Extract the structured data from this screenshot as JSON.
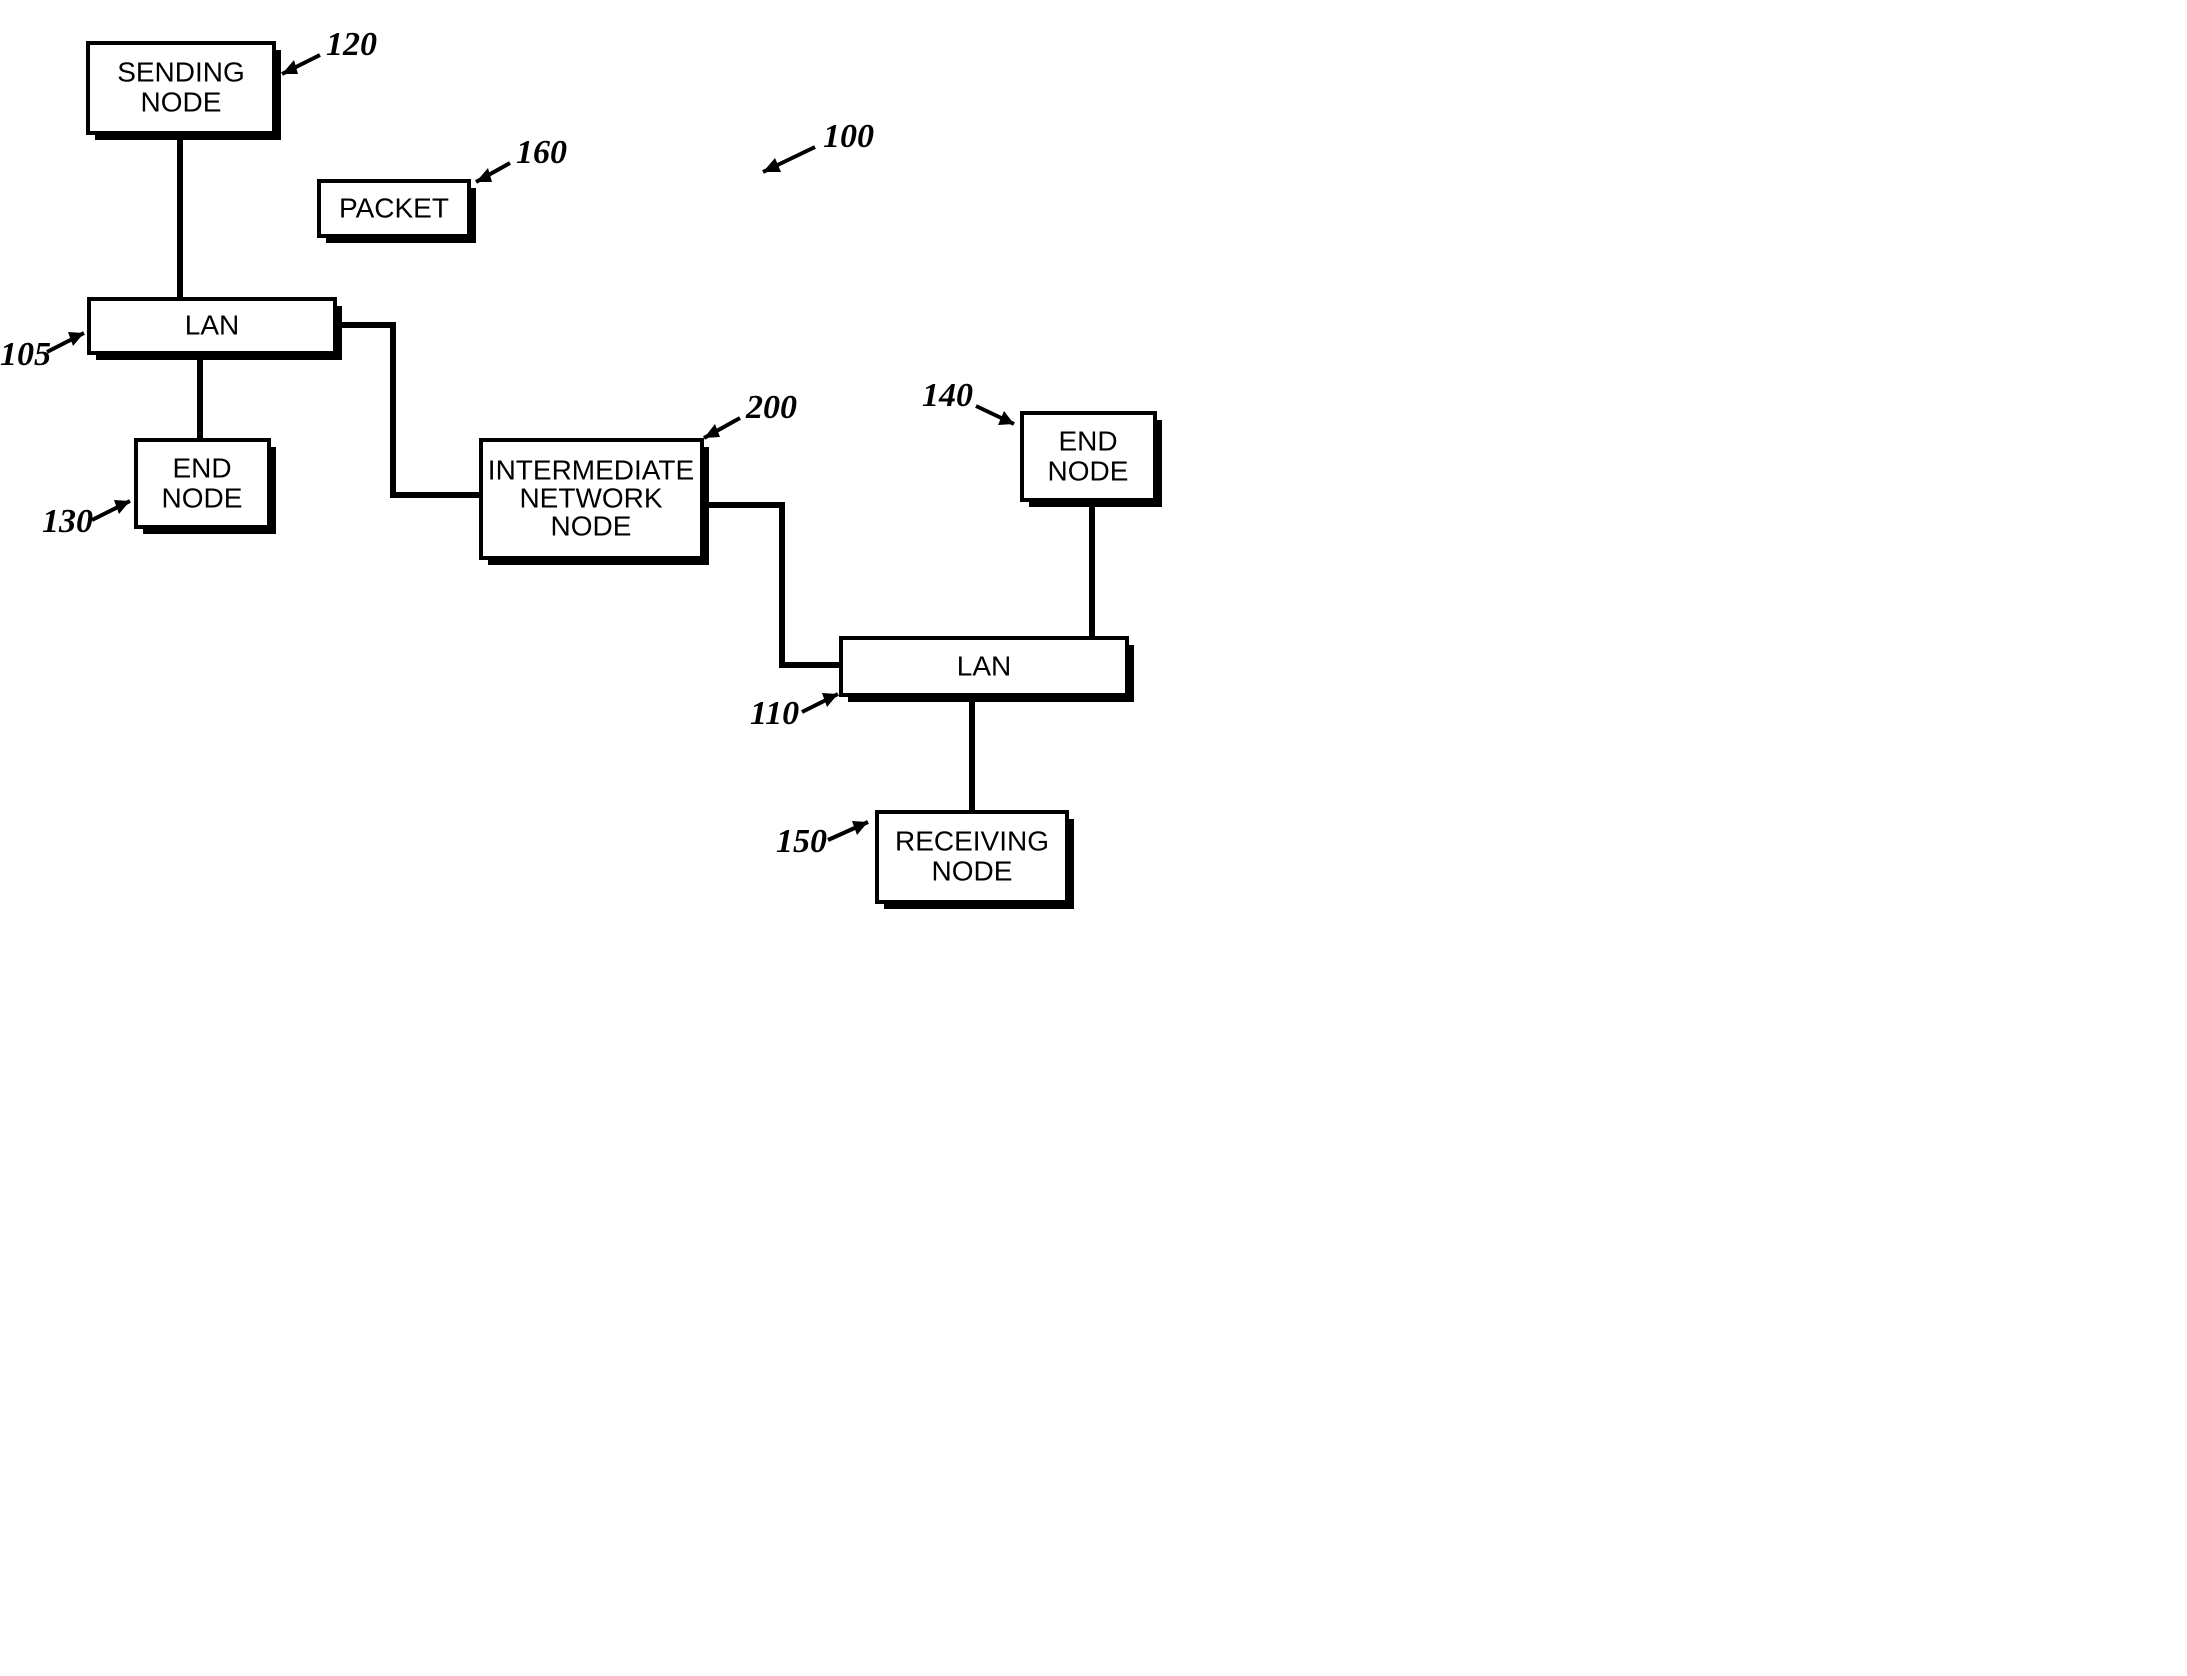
{
  "diagram": {
    "overall_ref": "100",
    "nodes": {
      "sending_node": {
        "label_l1": "SENDING",
        "label_l2": "NODE",
        "ref": "120"
      },
      "packet": {
        "label": "PACKET",
        "ref": "160"
      },
      "lan1": {
        "label": "LAN",
        "ref": "105"
      },
      "end_node1": {
        "label_l1": "END",
        "label_l2": "NODE",
        "ref": "130"
      },
      "intermediate": {
        "label_l1": "INTERMEDIATE",
        "label_l2": "NETWORK",
        "label_l3": "NODE",
        "ref": "200"
      },
      "end_node2": {
        "label_l1": "END",
        "label_l2": "NODE",
        "ref": "140"
      },
      "lan2": {
        "label": "LAN",
        "ref": "110"
      },
      "receiving_node": {
        "label_l1": "RECEIVING",
        "label_l2": "NODE",
        "ref": "150"
      }
    }
  }
}
